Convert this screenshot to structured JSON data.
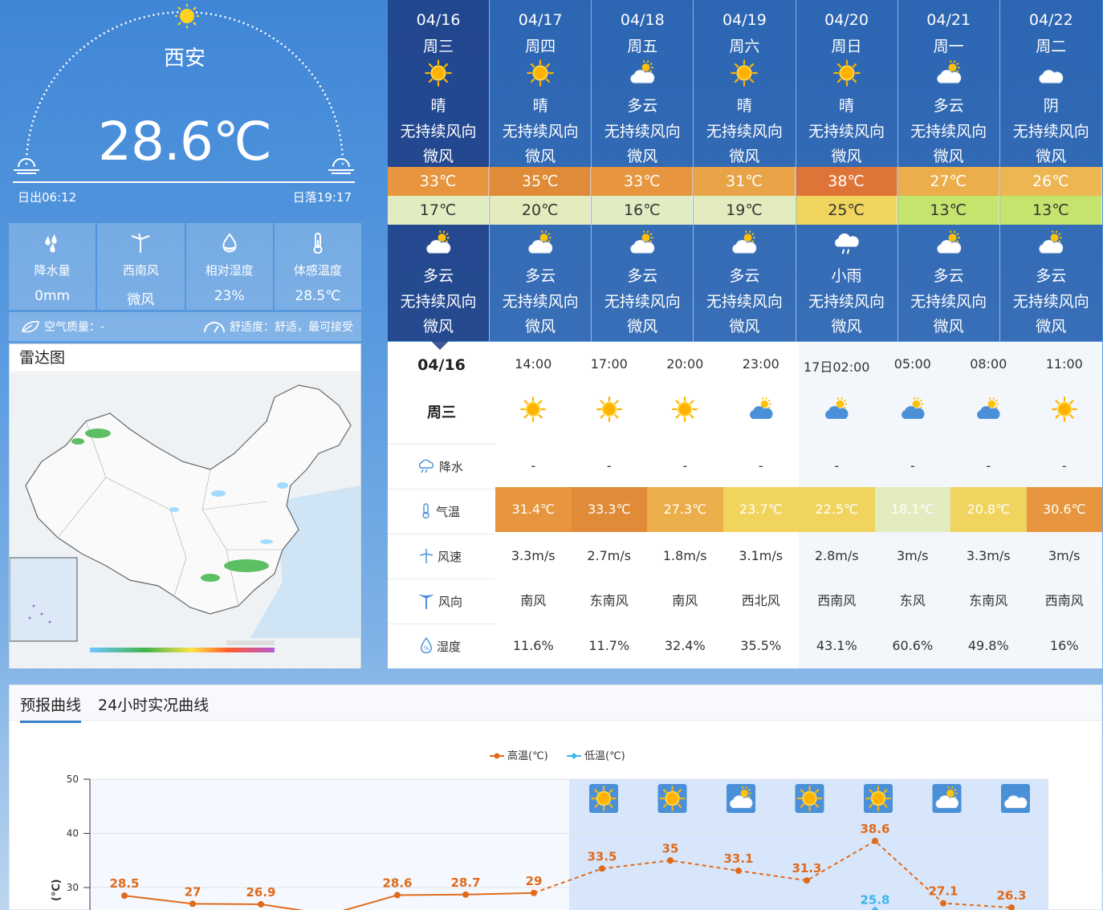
{
  "current": {
    "city": "西安",
    "temperature": "28.6℃",
    "sunrise": "日出06:12",
    "sunset": "日落19:17",
    "stats": [
      {
        "label": "降水量",
        "value": "0mm",
        "icon": "raindrops-icon"
      },
      {
        "label": "西南风",
        "value": "微风",
        "icon": "wind-turbine-icon"
      },
      {
        "label": "相对湿度",
        "value": "23%",
        "icon": "humidity-drop-icon"
      },
      {
        "label": "体感温度",
        "value": "28.5℃",
        "icon": "thermometer-icon"
      }
    ],
    "air_quality": "空气质量：-",
    "comfort": "舒适度：舒适，最可接受"
  },
  "radar": {
    "title": "雷达图"
  },
  "colors": {
    "hi_33": "#e7953e",
    "hi_35": "#e08b38",
    "hi_31": "#e9a447",
    "hi_38": "#df7438",
    "hi_27": "#ebae4b",
    "hi_26": "#edb653",
    "lo_17": "#e1ecc0",
    "lo_20": "#e5ebbd",
    "lo_16": "#e0edc3",
    "lo_19": "#e2ecbf",
    "lo_25": "#f0d45e",
    "lo_13": "#c5e46d"
  },
  "forecast": [
    {
      "date": "04/16",
      "weekday": "周三",
      "day_icon": "sun-icon",
      "day_weather": "晴",
      "day_wind_dir": "无持续风向",
      "day_wind": "微风",
      "high": "33℃",
      "low": "17℃",
      "night_icon": "partly-cloudy-icon",
      "night_weather": "多云",
      "night_wind_dir": "无持续风向",
      "night_wind": "微风",
      "hi_color": "#e7953e",
      "lo_color": "#e1ecc0"
    },
    {
      "date": "04/17",
      "weekday": "周四",
      "day_icon": "sun-icon",
      "day_weather": "晴",
      "day_wind_dir": "无持续风向",
      "day_wind": "微风",
      "high": "35℃",
      "low": "20℃",
      "night_icon": "partly-cloudy-icon",
      "night_weather": "多云",
      "night_wind_dir": "无持续风向",
      "night_wind": "微风",
      "hi_color": "#e08b38",
      "lo_color": "#e5ebbd"
    },
    {
      "date": "04/18",
      "weekday": "周五",
      "day_icon": "partly-cloudy-icon",
      "day_weather": "多云",
      "day_wind_dir": "无持续风向",
      "day_wind": "微风",
      "high": "33℃",
      "low": "16℃",
      "night_icon": "partly-cloudy-icon",
      "night_weather": "多云",
      "night_wind_dir": "无持续风向",
      "night_wind": "微风",
      "hi_color": "#e7953e",
      "lo_color": "#e0edc3"
    },
    {
      "date": "04/19",
      "weekday": "周六",
      "day_icon": "sun-icon",
      "day_weather": "晴",
      "day_wind_dir": "无持续风向",
      "day_wind": "微风",
      "high": "31℃",
      "low": "19℃",
      "night_icon": "partly-cloudy-icon",
      "night_weather": "多云",
      "night_wind_dir": "无持续风向",
      "night_wind": "微风",
      "hi_color": "#e9a447",
      "lo_color": "#e2ecbf"
    },
    {
      "date": "04/20",
      "weekday": "周日",
      "day_icon": "sun-icon",
      "day_weather": "晴",
      "day_wind_dir": "无持续风向",
      "day_wind": "微风",
      "high": "38℃",
      "low": "25℃",
      "night_icon": "light-rain-icon",
      "night_weather": "小雨",
      "night_wind_dir": "无持续风向",
      "night_wind": "微风",
      "hi_color": "#df7438",
      "lo_color": "#f0d45e"
    },
    {
      "date": "04/21",
      "weekday": "周一",
      "day_icon": "partly-cloudy-icon",
      "day_weather": "多云",
      "day_wind_dir": "无持续风向",
      "day_wind": "微风",
      "high": "27℃",
      "low": "13℃",
      "night_icon": "partly-cloudy-icon",
      "night_weather": "多云",
      "night_wind_dir": "无持续风向",
      "night_wind": "微风",
      "hi_color": "#ebae4b",
      "lo_color": "#c5e46d"
    },
    {
      "date": "04/22",
      "weekday": "周二",
      "day_icon": "cloud-icon",
      "day_weather": "阴",
      "day_wind_dir": "无持续风向",
      "day_wind": "微风",
      "high": "26℃",
      "low": "13℃",
      "night_icon": "partly-cloudy-icon",
      "night_weather": "多云",
      "night_wind_dir": "无持续风向",
      "night_wind": "微风",
      "hi_color": "#edb653",
      "lo_color": "#c5e46d"
    }
  ],
  "hourly": {
    "date": "04/16",
    "weekday": "周三",
    "row_labels": [
      "降水",
      "气温",
      "风速",
      "风向",
      "湿度"
    ],
    "row_icons": [
      "rain-cloud-icon",
      "thermometer-icon",
      "wind-speed-icon",
      "wind-direction-icon",
      "humidity-drop-icon"
    ],
    "items": [
      {
        "time": "14:00",
        "icon": "sun-icon",
        "rain": "-",
        "temp": "31.4℃",
        "wind_speed": "3.3m/s",
        "wind_dir": "南风",
        "humidity": "11.6%",
        "color": "#e7953e"
      },
      {
        "time": "17:00",
        "icon": "sun-icon",
        "rain": "-",
        "temp": "33.3℃",
        "wind_speed": "2.7m/s",
        "wind_dir": "东南风",
        "humidity": "11.7%",
        "color": "#e08b38"
      },
      {
        "time": "20:00",
        "icon": "sun-icon",
        "rain": "-",
        "temp": "27.3℃",
        "wind_speed": "1.8m/s",
        "wind_dir": "南风",
        "humidity": "32.4%",
        "color": "#ebae4b"
      },
      {
        "time": "23:00",
        "icon": "cloudy-night-icon",
        "rain": "-",
        "temp": "23.7℃",
        "wind_speed": "3.1m/s",
        "wind_dir": "西北风",
        "humidity": "35.5%",
        "color": "#f0d45e"
      },
      {
        "time": "17日02:00",
        "icon": "cloudy-night-icon",
        "rain": "-",
        "temp": "22.5℃",
        "wind_speed": "2.8m/s",
        "wind_dir": "西南风",
        "humidity": "43.1%",
        "color": "#f0d45e"
      },
      {
        "time": "05:00",
        "icon": "cloudy-night-icon",
        "rain": "-",
        "temp": "18.1℃",
        "wind_speed": "3m/s",
        "wind_dir": "东风",
        "humidity": "60.6%",
        "color": "#e2ecbf"
      },
      {
        "time": "08:00",
        "icon": "cloudy-night-icon",
        "rain": "-",
        "temp": "20.8℃",
        "wind_speed": "3.3m/s",
        "wind_dir": "东南风",
        "humidity": "49.8%",
        "color": "#f0d45e"
      },
      {
        "time": "11:00",
        "icon": "sun-icon",
        "rain": "-",
        "temp": "30.6℃",
        "wind_speed": "3m/s",
        "wind_dir": "西南风",
        "humidity": "16%",
        "color": "#e7953e"
      }
    ]
  },
  "curve_tabs": [
    "预报曲线",
    "24小时实况曲线"
  ],
  "chart_data": {
    "type": "line",
    "legend": [
      "高温(℃)",
      "低温(℃)"
    ],
    "legend_position": "top-center",
    "ylim": [
      0,
      50
    ],
    "yticks": [
      30,
      40,
      50
    ],
    "ylabel": "(℃)",
    "grid": true,
    "series": [
      {
        "name": "高温(℃)",
        "color": "#e06a1b",
        "values": [
          28.5,
          27,
          26.9,
          25,
          28.6,
          28.7,
          29,
          33.5,
          35,
          33.1,
          31.3,
          38.6,
          27.1,
          26.3
        ],
        "labeled": [
          true,
          true,
          true,
          false,
          true,
          true,
          true,
          true,
          true,
          true,
          true,
          true,
          true,
          true
        ]
      },
      {
        "name": "低温(℃)",
        "color": "#3cb6ec",
        "values": [
          null,
          null,
          null,
          null,
          null,
          null,
          null,
          null,
          null,
          null,
          null,
          25.8,
          null,
          null
        ],
        "labeled": [
          false,
          false,
          false,
          false,
          false,
          false,
          false,
          false,
          false,
          false,
          false,
          true,
          false,
          false
        ]
      }
    ],
    "forecast_icons": [
      "sun-icon",
      "sun-icon",
      "partly-cloudy-icon",
      "sun-icon",
      "sun-icon",
      "partly-cloudy-icon",
      "cloud-icon"
    ]
  }
}
